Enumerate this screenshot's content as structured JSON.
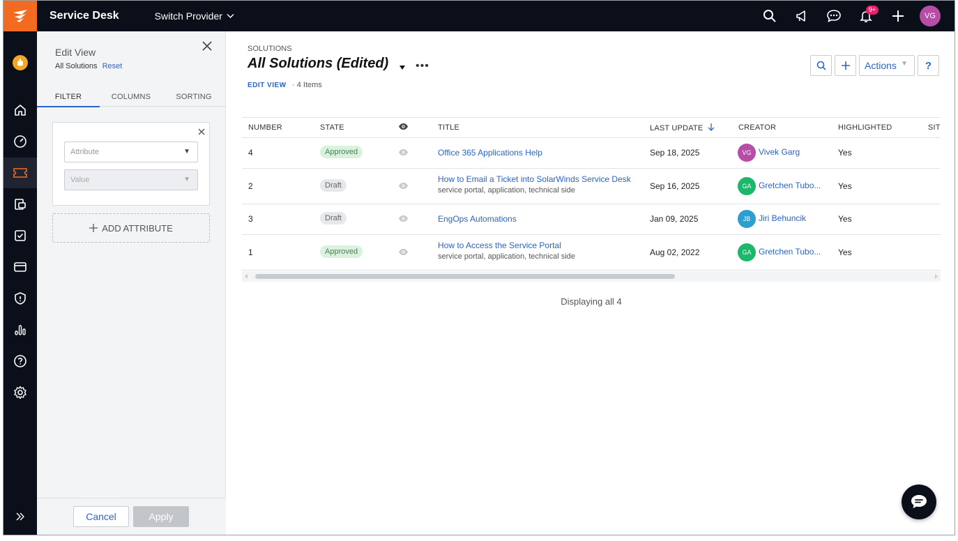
{
  "app": {
    "title": "Service Desk",
    "switch_provider": "Switch Provider",
    "notif_count": "9+",
    "user_initials": "VG"
  },
  "panel": {
    "title": "Edit View",
    "view_name": "All Solutions",
    "reset": "Reset",
    "tabs": [
      "FILTER",
      "COLUMNS",
      "SORTING"
    ],
    "attribute_placeholder": "Attribute",
    "value_placeholder": "Value",
    "add_attribute": "ADD ATTRIBUTE",
    "cancel": "Cancel",
    "apply": "Apply"
  },
  "main": {
    "breadcrumb": "SOLUTIONS",
    "title": "All Solutions (Edited)",
    "edit_view": "EDIT VIEW",
    "items_count": "· 4 Items",
    "actions": "Actions",
    "help": "?",
    "displaying": "Displaying all 4"
  },
  "table": {
    "headers": {
      "number": "NUMBER",
      "state": "STATE",
      "title": "TITLE",
      "last_update": "LAST UPDATE",
      "creator": "CREATOR",
      "highlighted": "HIGHLIGHTED",
      "site": "SITE"
    },
    "rows": [
      {
        "number": "4",
        "state": "Approved",
        "title": "Office 365 Applications Help",
        "tags": "",
        "last_update": "Sep 18, 2025",
        "creator_initials": "VG",
        "creator": "Vivek Garg",
        "creator_color": "#b84da8",
        "highlighted": "Yes"
      },
      {
        "number": "2",
        "state": "Draft",
        "title": "How to Email a Ticket into SolarWinds Service Desk",
        "tags": "service portal, application, technical side",
        "last_update": "Sep 16, 2025",
        "creator_initials": "GA",
        "creator": "Gretchen Tubo...",
        "creator_color": "#1bb86a",
        "highlighted": "Yes"
      },
      {
        "number": "3",
        "state": "Draft",
        "title": "EngOps Automations",
        "tags": "",
        "last_update": "Jan 09, 2025",
        "creator_initials": "JB",
        "creator": "Jiri Behuncik",
        "creator_color": "#2b9fcf",
        "highlighted": "Yes"
      },
      {
        "number": "1",
        "state": "Approved",
        "title": "How to Access the Service Portal",
        "tags": "service portal, application, technical side",
        "last_update": "Aug 02, 2022",
        "creator_initials": "GA",
        "creator": "Gretchen Tubo...",
        "creator_color": "#1bb86a",
        "highlighted": "Yes"
      }
    ]
  },
  "colors": {
    "accent": "#2a63c9",
    "nav_bg": "#0b0f19",
    "brand_orange": "#f36a21",
    "approved_bg": "#d9f2dd",
    "draft_bg": "#e6e8eb"
  }
}
